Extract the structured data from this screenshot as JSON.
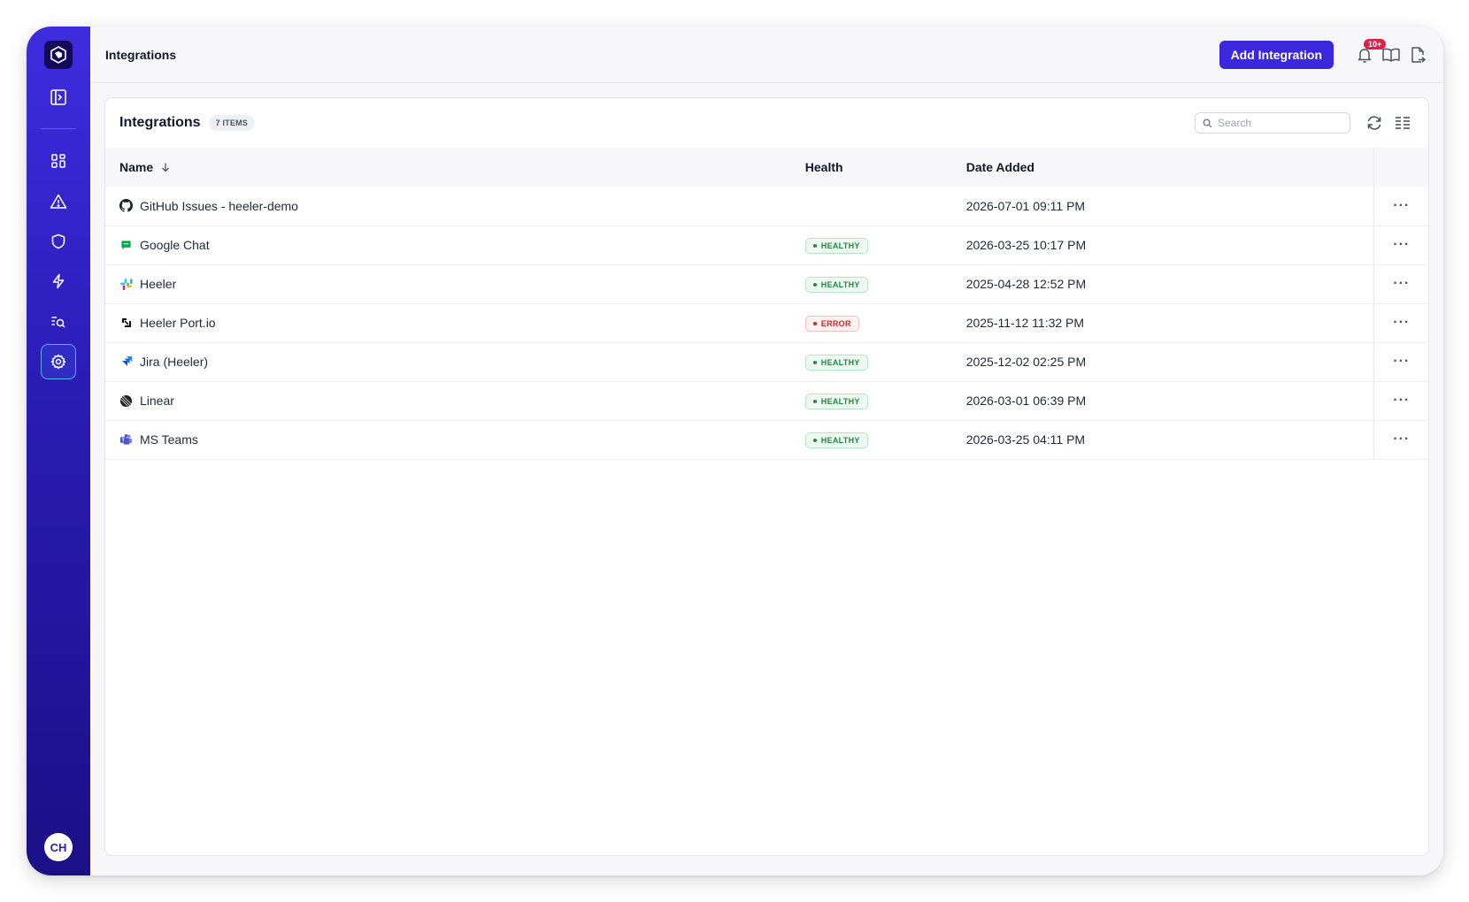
{
  "topbar": {
    "title": "Integrations",
    "add_button": "Add Integration",
    "notification_count": "10+"
  },
  "card": {
    "title": "Integrations",
    "count_label": "7 ITEMS",
    "search_placeholder": "Search"
  },
  "table": {
    "columns": {
      "name": "Name",
      "health": "Health",
      "date": "Date Added"
    },
    "rows": [
      {
        "name": "GitHub Issues - heeler-demo",
        "icon": "github-icon",
        "health": "",
        "health_status": "none",
        "date": "2026-07-01 09:11 PM"
      },
      {
        "name": "Google Chat",
        "icon": "google-chat-icon",
        "health": "HEALTHY",
        "health_status": "healthy",
        "date": "2026-03-25 10:17 PM"
      },
      {
        "name": "Heeler",
        "icon": "slack-icon",
        "health": "HEALTHY",
        "health_status": "healthy",
        "date": "2025-04-28 12:52 PM"
      },
      {
        "name": "Heeler Port.io",
        "icon": "port-icon",
        "health": "ERROR",
        "health_status": "error",
        "date": "2025-11-12 11:32 PM"
      },
      {
        "name": "Jira (Heeler)",
        "icon": "jira-icon",
        "health": "HEALTHY",
        "health_status": "healthy",
        "date": "2025-12-02 02:25 PM"
      },
      {
        "name": "Linear",
        "icon": "linear-icon",
        "health": "HEALTHY",
        "health_status": "healthy",
        "date": "2026-03-01 06:39 PM"
      },
      {
        "name": "MS Teams",
        "icon": "ms-teams-icon",
        "health": "HEALTHY",
        "health_status": "healthy",
        "date": "2026-03-25 04:11 PM"
      }
    ],
    "row_action_label": "···"
  },
  "user": {
    "initials": "CH"
  },
  "colors": {
    "sidebar_top": "#3f2ce0",
    "sidebar_bottom": "#1c0f86",
    "primary": "#3b27dc",
    "healthy": "#1f8a3e",
    "error": "#c62828",
    "badge": "#e21d48"
  }
}
